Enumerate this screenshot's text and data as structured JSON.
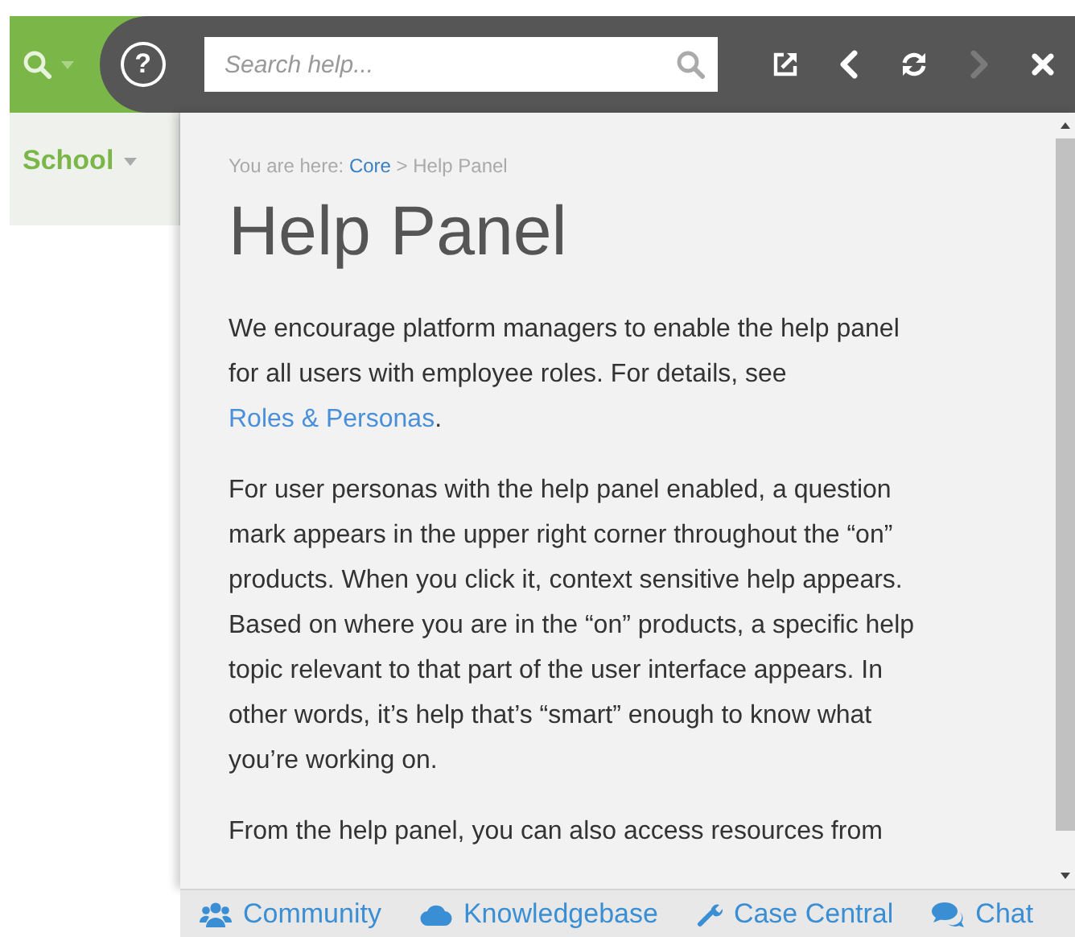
{
  "app": {
    "menu": {
      "label": "School"
    }
  },
  "help_bar": {
    "help_glyph": "?",
    "search": {
      "placeholder": "Search help..."
    },
    "buttons": [
      {
        "kind": "popout",
        "disabled": false
      },
      {
        "kind": "back",
        "disabled": false
      },
      {
        "kind": "refresh",
        "disabled": false
      },
      {
        "kind": "forward",
        "disabled": true
      },
      {
        "kind": "close",
        "disabled": false
      }
    ]
  },
  "breadcrumb": {
    "prefix": "You are here:",
    "link": "Core",
    "separator": ">",
    "current": "Help Panel"
  },
  "title": "Help Panel",
  "paragraphs": [
    {
      "parts": [
        {
          "kind": "text",
          "text": "We encourage platform managers to enable the help panel for all users with employee roles. For details, see "
        },
        {
          "kind": "link",
          "text": "Roles & Personas"
        },
        {
          "kind": "text",
          "text": "."
        }
      ]
    },
    {
      "parts": [
        {
          "kind": "text",
          "text": "For user personas with the help panel enabled, a question mark appears in the upper right corner throughout the “on” products. When you click it, context sensitive help appears. Based on where you are in the “on” products, a specific help topic relevant to that part of the user interface appears. In other words, it’s help that’s “smart” enough to know what you’re working on."
        }
      ]
    },
    {
      "parts": [
        {
          "kind": "text",
          "text": "From the help panel, you can also access resources from"
        }
      ]
    }
  ],
  "footer_links": [
    {
      "kind": "community",
      "label": "Community"
    },
    {
      "kind": "knowledgebase",
      "label": "Knowledgebase"
    },
    {
      "kind": "case",
      "label": "Case Central"
    },
    {
      "kind": "chat",
      "label": "Chat"
    }
  ]
}
